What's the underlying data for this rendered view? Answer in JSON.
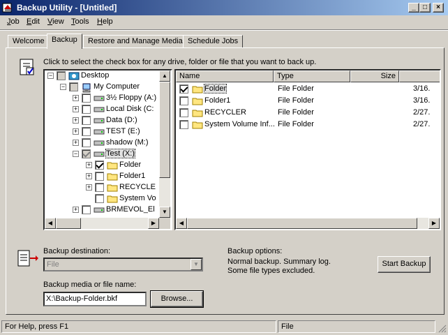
{
  "window": {
    "title": "Backup Utility - [Untitled]"
  },
  "menu": [
    {
      "label": "Job",
      "key": "J",
      "rest": "ob"
    },
    {
      "label": "Edit",
      "key": "E",
      "rest": "dit"
    },
    {
      "label": "View",
      "key": "V",
      "rest": "iew"
    },
    {
      "label": "Tools",
      "key": "T",
      "rest": "ools"
    },
    {
      "label": "Help",
      "key": "H",
      "rest": "elp"
    }
  ],
  "tabs": [
    "Welcome",
    "Backup",
    "Restore and Manage Media",
    "Schedule Jobs"
  ],
  "instruction": "Click to select the check box for any drive, folder or file that you want to back up.",
  "tree": [
    {
      "label": "Desktop",
      "level": 0,
      "expander": "-",
      "checked": false
    },
    {
      "label": "My Computer",
      "level": 1,
      "expander": "-",
      "checked": false
    },
    {
      "label": "3½ Floppy (A:)",
      "level": 2,
      "expander": "+",
      "checked": false
    },
    {
      "label": "Local Disk (C:",
      "level": 2,
      "expander": "+",
      "checked": false
    },
    {
      "label": "Data (D:)",
      "level": 2,
      "expander": "+",
      "checked": false
    },
    {
      "label": "TEST (E:)",
      "level": 2,
      "expander": "+",
      "checked": false
    },
    {
      "label": "shadow (M:)",
      "level": 2,
      "expander": "+",
      "checked": false
    },
    {
      "label": "Test (X:)",
      "level": 2,
      "expander": "-",
      "checked": true
    },
    {
      "label": "Folder",
      "level": 3,
      "expander": "+",
      "checked": true
    },
    {
      "label": "Folder1",
      "level": 3,
      "expander": "+",
      "checked": false
    },
    {
      "label": "RECYCLE",
      "level": 3,
      "expander": "+",
      "checked": false
    },
    {
      "label": "System Vo",
      "level": 3,
      "expander": "",
      "checked": false
    },
    {
      "label": "BRMEVOL_El",
      "level": 2,
      "expander": "+",
      "checked": false
    }
  ],
  "list": {
    "columns": [
      "Name",
      "Type",
      "Size"
    ],
    "rows": [
      {
        "name": "Folder",
        "type": "File Folder",
        "date": "3/16.",
        "checked": true
      },
      {
        "name": "Folder1",
        "type": "File Folder",
        "date": "3/16.",
        "checked": false
      },
      {
        "name": "RECYCLER",
        "type": "File Folder",
        "date": "2/27.",
        "checked": false
      },
      {
        "name": "System Volume Inf...",
        "type": "File Folder",
        "date": "2/27.",
        "checked": false
      }
    ]
  },
  "destination": {
    "label": "Backup destination:",
    "value": "File"
  },
  "media": {
    "label": "Backup media or file name:",
    "value": "X:\\Backup-Folder.bkf"
  },
  "browse_label": "Browse...",
  "options": {
    "label": "Backup options:",
    "line1": "Normal backup.  Summary log.",
    "line2": "Some file types excluded."
  },
  "start_label": "Start Backup",
  "status": {
    "help": "For Help, press F1",
    "mode": "File"
  },
  "icons": {
    "app": "backup-app-icon",
    "computer": "my-computer-icon",
    "drive": "drive-icon",
    "folder": "folder-icon"
  }
}
